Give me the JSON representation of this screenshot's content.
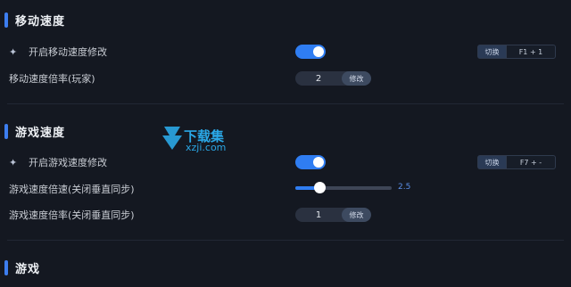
{
  "sections": {
    "move_speed": {
      "title": "移动速度",
      "enable_label": "开启移动速度修改",
      "hotkey": {
        "button": "切换",
        "keys": "F1 + 1"
      },
      "multiplier_label": "移动速度倍率(玩家)",
      "multiplier_value": "2",
      "modify_label": "修改"
    },
    "game_speed": {
      "title": "游戏速度",
      "enable_label": "开启游戏速度修改",
      "hotkey": {
        "button": "切换",
        "keys": "F7 + -"
      },
      "speed_label": "游戏速度倍速(关闭垂直同步)",
      "slider_value": "2.5",
      "slider_fraction": 0.25,
      "multiplier_label": "游戏速度倍率(关闭垂直同步)",
      "multiplier_value": "1",
      "modify_label": "修改"
    },
    "game": {
      "title": "游戏"
    }
  },
  "watermark": {
    "text": "下载集",
    "url": "xzji.com"
  },
  "colors": {
    "accent": "#2f7df2",
    "background": "#141821",
    "watermark": "#2aa7e6"
  },
  "icons": {
    "feature_icon": "sparkle-icon"
  }
}
